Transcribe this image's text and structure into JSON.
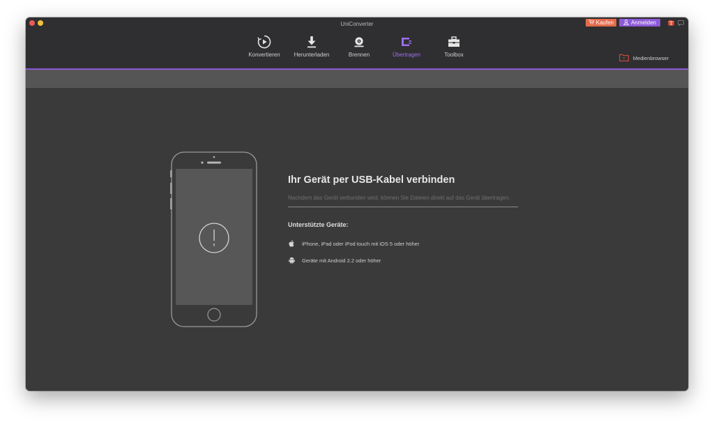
{
  "window": {
    "title": "UniConverter"
  },
  "header": {
    "buy_label": "Kaufen",
    "login_label": "Anmelden"
  },
  "tabs": [
    {
      "label": "Konvertieren",
      "icon": "convert-icon",
      "active": false
    },
    {
      "label": "Herunterladen",
      "icon": "download-icon",
      "active": false
    },
    {
      "label": "Brennen",
      "icon": "burn-icon",
      "active": false
    },
    {
      "label": "Übertragen",
      "icon": "transfer-icon",
      "active": true
    },
    {
      "label": "Toolbox",
      "icon": "toolbox-icon",
      "active": false
    }
  ],
  "media_browser": {
    "label": "Medienbrowser",
    "icon": "folder-icon"
  },
  "main": {
    "heading": "Ihr Gerät per USB-Kabel verbinden",
    "description": "Nachdem das Gerät verbunden wird, können Sie Dateien direkt auf das Gerät übertragen.",
    "supported_title": "Unterstützte Geräte:",
    "requirements": [
      {
        "icon": "apple-icon",
        "text": "iPhone, iPad oder iPod touch mit iOS 5 oder höher"
      },
      {
        "icon": "android-icon",
        "text": "Geräte mit Android 2.2 oder höher"
      }
    ]
  },
  "colors": {
    "accent": "#8a5ad6",
    "buy_button": "#e46a4b",
    "login_button": "#8c5ad8",
    "background": "#3a3a3a",
    "titlebar": "#2f2f31"
  }
}
